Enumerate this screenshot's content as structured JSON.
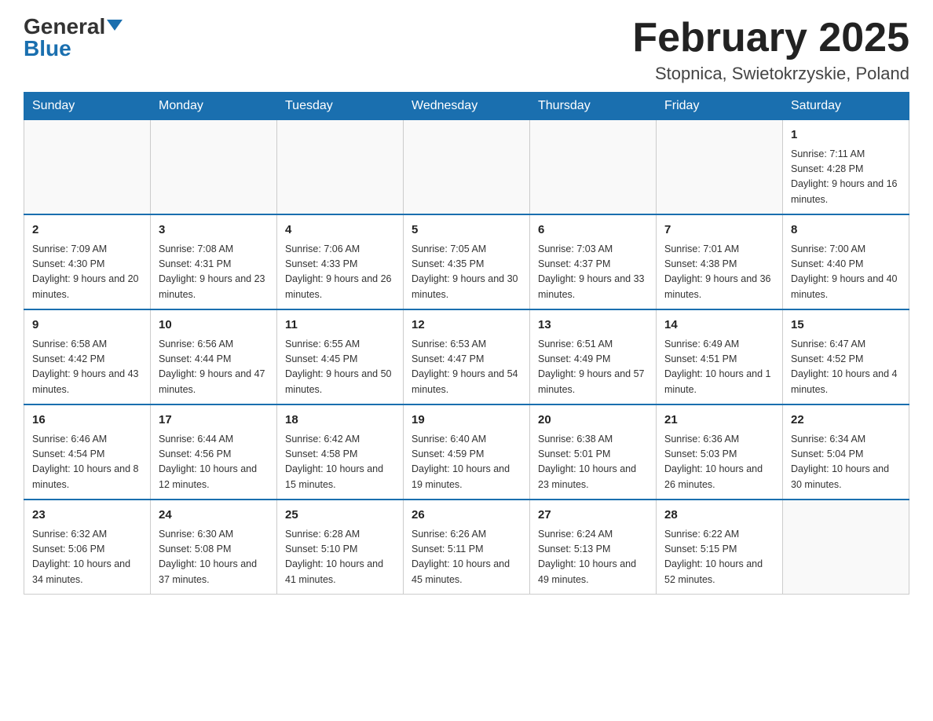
{
  "logo": {
    "general": "General",
    "blue": "Blue"
  },
  "header": {
    "month_title": "February 2025",
    "location": "Stopnica, Swietokrzyskie, Poland"
  },
  "days_of_week": [
    "Sunday",
    "Monday",
    "Tuesday",
    "Wednesday",
    "Thursday",
    "Friday",
    "Saturday"
  ],
  "weeks": [
    [
      {
        "day": "",
        "info": ""
      },
      {
        "day": "",
        "info": ""
      },
      {
        "day": "",
        "info": ""
      },
      {
        "day": "",
        "info": ""
      },
      {
        "day": "",
        "info": ""
      },
      {
        "day": "",
        "info": ""
      },
      {
        "day": "1",
        "info": "Sunrise: 7:11 AM\nSunset: 4:28 PM\nDaylight: 9 hours and 16 minutes."
      }
    ],
    [
      {
        "day": "2",
        "info": "Sunrise: 7:09 AM\nSunset: 4:30 PM\nDaylight: 9 hours and 20 minutes."
      },
      {
        "day": "3",
        "info": "Sunrise: 7:08 AM\nSunset: 4:31 PM\nDaylight: 9 hours and 23 minutes."
      },
      {
        "day": "4",
        "info": "Sunrise: 7:06 AM\nSunset: 4:33 PM\nDaylight: 9 hours and 26 minutes."
      },
      {
        "day": "5",
        "info": "Sunrise: 7:05 AM\nSunset: 4:35 PM\nDaylight: 9 hours and 30 minutes."
      },
      {
        "day": "6",
        "info": "Sunrise: 7:03 AM\nSunset: 4:37 PM\nDaylight: 9 hours and 33 minutes."
      },
      {
        "day": "7",
        "info": "Sunrise: 7:01 AM\nSunset: 4:38 PM\nDaylight: 9 hours and 36 minutes."
      },
      {
        "day": "8",
        "info": "Sunrise: 7:00 AM\nSunset: 4:40 PM\nDaylight: 9 hours and 40 minutes."
      }
    ],
    [
      {
        "day": "9",
        "info": "Sunrise: 6:58 AM\nSunset: 4:42 PM\nDaylight: 9 hours and 43 minutes."
      },
      {
        "day": "10",
        "info": "Sunrise: 6:56 AM\nSunset: 4:44 PM\nDaylight: 9 hours and 47 minutes."
      },
      {
        "day": "11",
        "info": "Sunrise: 6:55 AM\nSunset: 4:45 PM\nDaylight: 9 hours and 50 minutes."
      },
      {
        "day": "12",
        "info": "Sunrise: 6:53 AM\nSunset: 4:47 PM\nDaylight: 9 hours and 54 minutes."
      },
      {
        "day": "13",
        "info": "Sunrise: 6:51 AM\nSunset: 4:49 PM\nDaylight: 9 hours and 57 minutes."
      },
      {
        "day": "14",
        "info": "Sunrise: 6:49 AM\nSunset: 4:51 PM\nDaylight: 10 hours and 1 minute."
      },
      {
        "day": "15",
        "info": "Sunrise: 6:47 AM\nSunset: 4:52 PM\nDaylight: 10 hours and 4 minutes."
      }
    ],
    [
      {
        "day": "16",
        "info": "Sunrise: 6:46 AM\nSunset: 4:54 PM\nDaylight: 10 hours and 8 minutes."
      },
      {
        "day": "17",
        "info": "Sunrise: 6:44 AM\nSunset: 4:56 PM\nDaylight: 10 hours and 12 minutes."
      },
      {
        "day": "18",
        "info": "Sunrise: 6:42 AM\nSunset: 4:58 PM\nDaylight: 10 hours and 15 minutes."
      },
      {
        "day": "19",
        "info": "Sunrise: 6:40 AM\nSunset: 4:59 PM\nDaylight: 10 hours and 19 minutes."
      },
      {
        "day": "20",
        "info": "Sunrise: 6:38 AM\nSunset: 5:01 PM\nDaylight: 10 hours and 23 minutes."
      },
      {
        "day": "21",
        "info": "Sunrise: 6:36 AM\nSunset: 5:03 PM\nDaylight: 10 hours and 26 minutes."
      },
      {
        "day": "22",
        "info": "Sunrise: 6:34 AM\nSunset: 5:04 PM\nDaylight: 10 hours and 30 minutes."
      }
    ],
    [
      {
        "day": "23",
        "info": "Sunrise: 6:32 AM\nSunset: 5:06 PM\nDaylight: 10 hours and 34 minutes."
      },
      {
        "day": "24",
        "info": "Sunrise: 6:30 AM\nSunset: 5:08 PM\nDaylight: 10 hours and 37 minutes."
      },
      {
        "day": "25",
        "info": "Sunrise: 6:28 AM\nSunset: 5:10 PM\nDaylight: 10 hours and 41 minutes."
      },
      {
        "day": "26",
        "info": "Sunrise: 6:26 AM\nSunset: 5:11 PM\nDaylight: 10 hours and 45 minutes."
      },
      {
        "day": "27",
        "info": "Sunrise: 6:24 AM\nSunset: 5:13 PM\nDaylight: 10 hours and 49 minutes."
      },
      {
        "day": "28",
        "info": "Sunrise: 6:22 AM\nSunset: 5:15 PM\nDaylight: 10 hours and 52 minutes."
      },
      {
        "day": "",
        "info": ""
      }
    ]
  ]
}
